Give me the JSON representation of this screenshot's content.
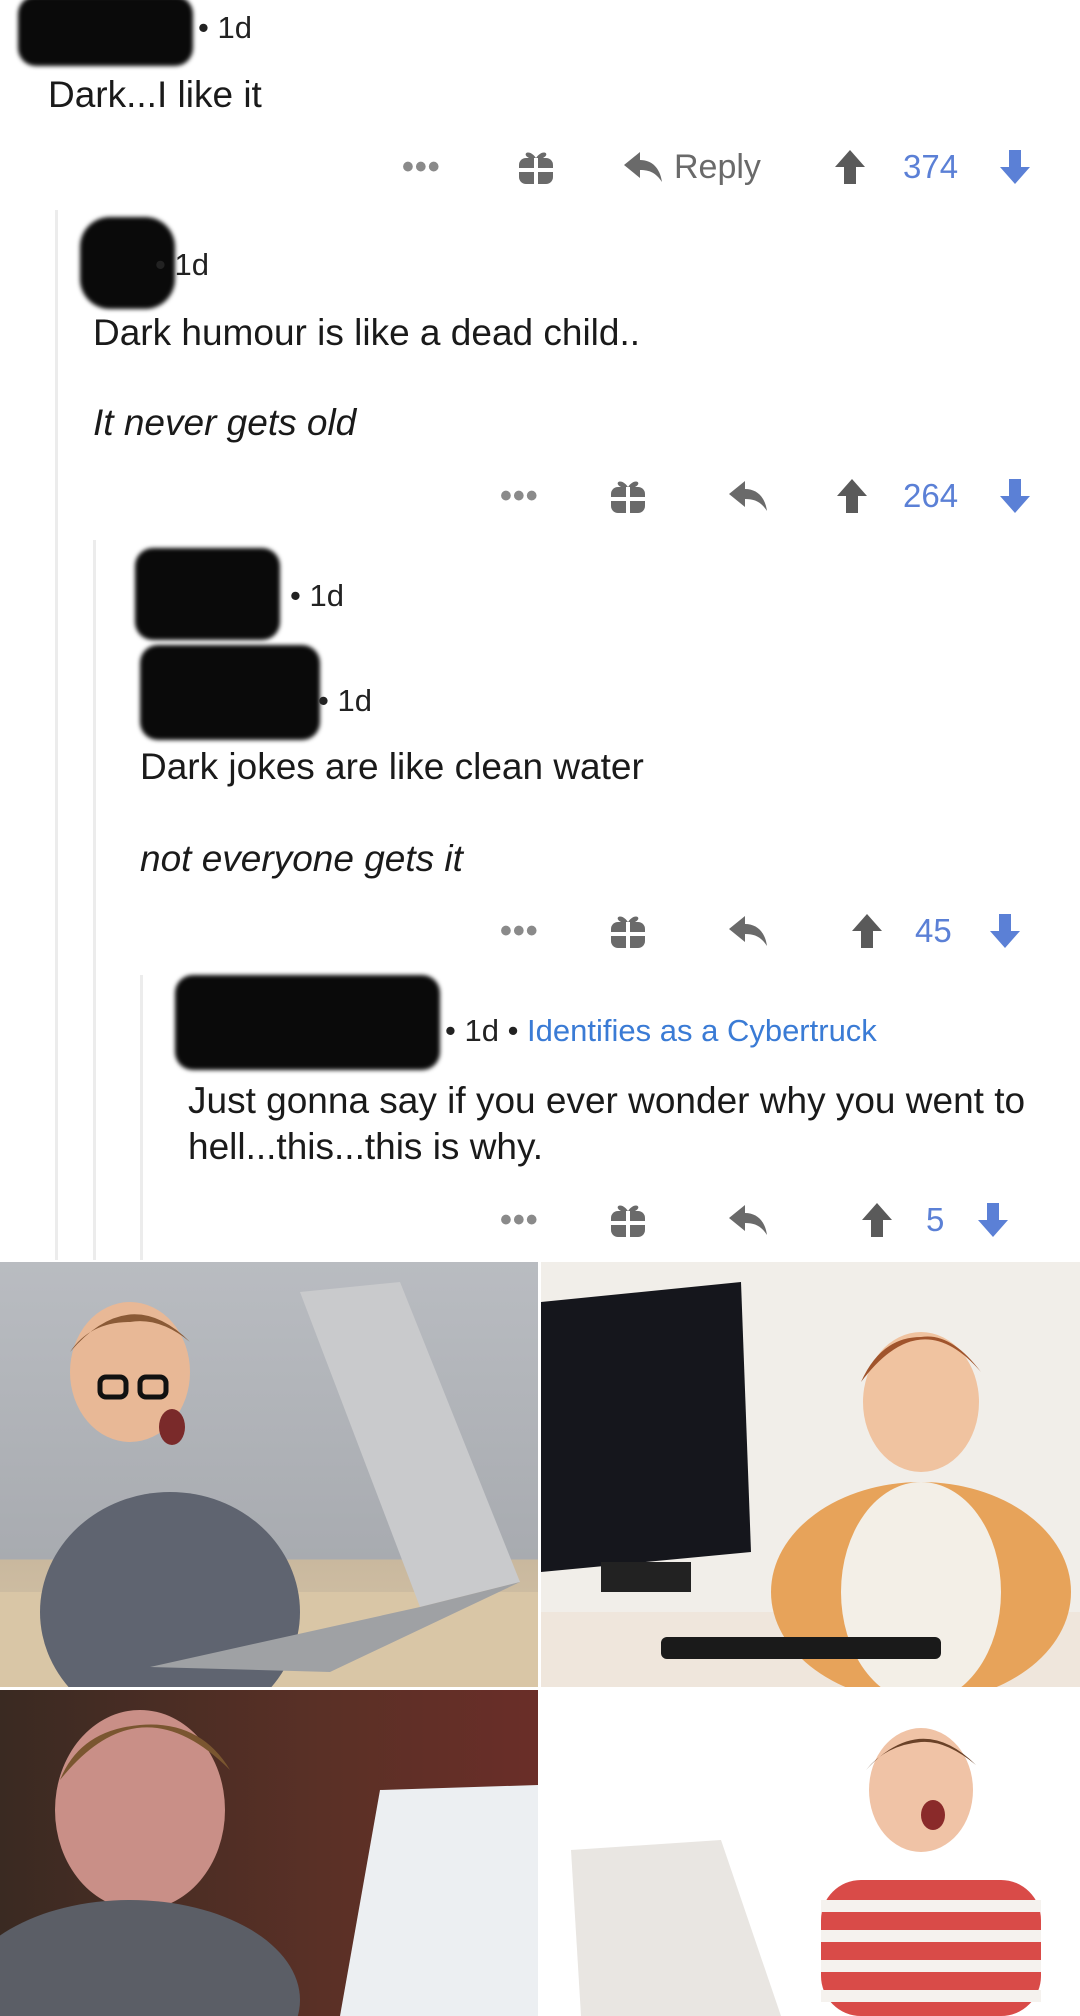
{
  "comments": [
    {
      "age": "1d",
      "body": "Dark...I like it",
      "reply_label": "Reply",
      "score": "374"
    },
    {
      "age": "1d",
      "body_lines": [
        "Dark humour is like a dead child..",
        "It never gets old"
      ],
      "score": "264"
    },
    {
      "age_top": "1d",
      "age": "1d",
      "body_lines": [
        "Dark jokes are like clean water",
        "not everyone gets it"
      ],
      "score": "45"
    },
    {
      "age": "1d",
      "flair": "Identifies as a Cybertruck",
      "body": "Just gonna say if you ever wonder why you went to hell...this...this is why.",
      "score": "5"
    }
  ],
  "more_label": "•••",
  "colors": {
    "score": "#5b80d6",
    "flair": "#3a7bd5",
    "icon": "#6a6a6a"
  }
}
